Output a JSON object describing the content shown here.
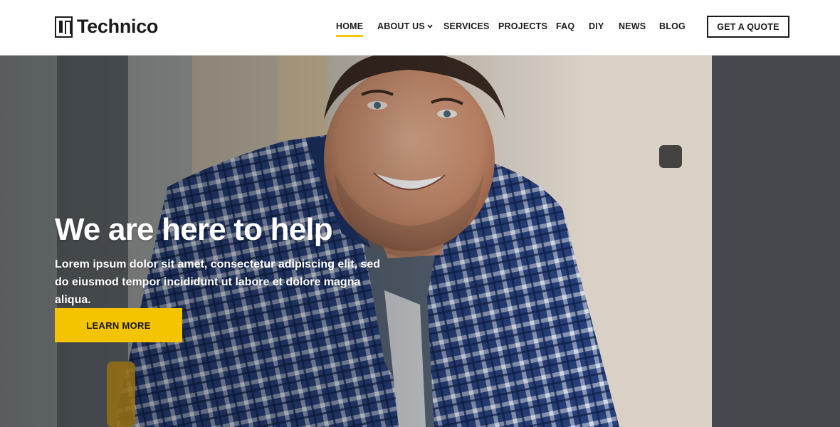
{
  "brand": {
    "name": "Technico",
    "logo_icon": "technico-logo-icon"
  },
  "nav": {
    "items": [
      {
        "label": "HOME",
        "active": true
      },
      {
        "label": "ABOUT US",
        "has_dropdown": true
      },
      {
        "label": "SERVICES"
      },
      {
        "label": "PROJECTS"
      },
      {
        "label": "FAQ"
      },
      {
        "label": "DIY"
      },
      {
        "label": "NEWS"
      },
      {
        "label": "BLOG"
      }
    ],
    "cta_label": "GET A QUOTE",
    "dropdown_icon": "chevron-down-icon"
  },
  "hero": {
    "title": "We are here to help",
    "text": "Lorem ipsum dolor sit amet, consectetur adipiscing elit, sed do eiusmod tempor incididunt ut labore et dolore magna aliqua.",
    "button_label": "LEARN MORE",
    "image": "smiling-man-plaid-shirt-photo"
  },
  "colors": {
    "accent": "#f5c400",
    "text_dark": "#1a1a1a",
    "header_bg": "#ffffff",
    "shirt_blue": "#27407a"
  }
}
